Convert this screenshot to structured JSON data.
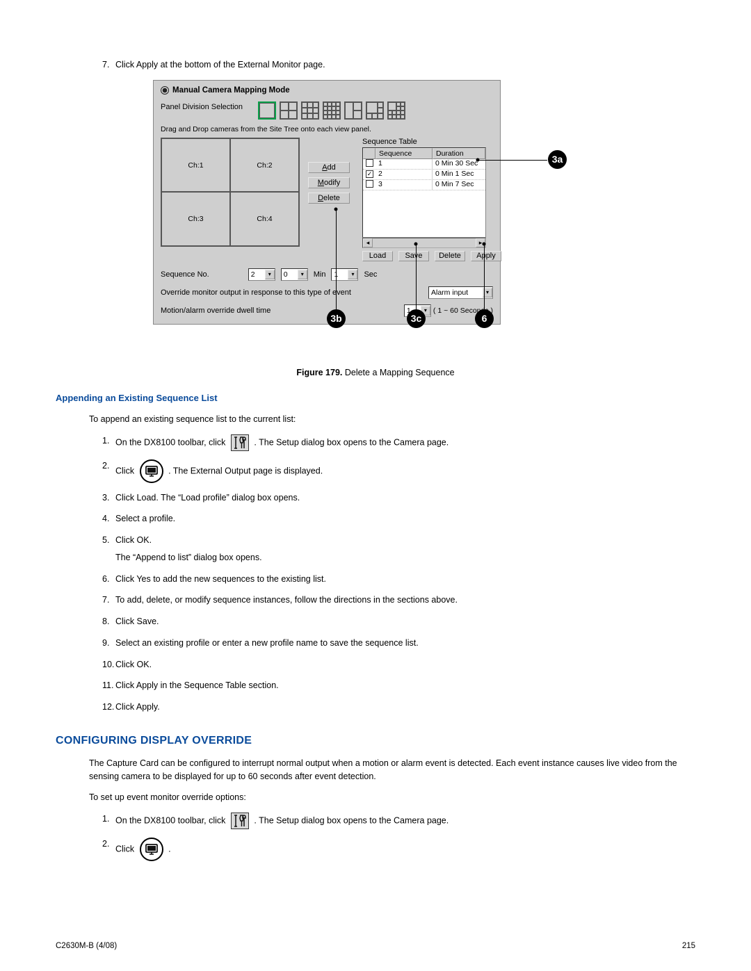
{
  "steps_intro": [
    {
      "num": "7",
      "text": "Click Apply at the bottom of the External Monitor page."
    }
  ],
  "diagram": {
    "mode_label": "Manual Camera Mapping Mode",
    "division_label": "Panel Division Selection",
    "drag_hint": "Drag and Drop cameras from the Site Tree onto each view panel.",
    "channels": [
      "Ch:1",
      "Ch:2",
      "Ch:3",
      "Ch:4"
    ],
    "btns": {
      "add": "Add",
      "modify": "Modify",
      "delete": "Delete"
    },
    "seq_table_title": "Sequence Table",
    "seq_headers": {
      "seq": "Sequence",
      "dur": "Duration"
    },
    "seq_rows": [
      {
        "checked": false,
        "seq": "1",
        "dur": "0 Min 30 Sec"
      },
      {
        "checked": true,
        "seq": "2",
        "dur": "0 Min 1 Sec"
      },
      {
        "checked": false,
        "seq": "3",
        "dur": "0 Min 7 Sec"
      }
    ],
    "bottom_btns": {
      "load": "Load",
      "save": "Save",
      "delete": "Delete",
      "apply": "Apply"
    },
    "seq_no_label": "Sequence No.",
    "seq_no_val": "2",
    "seq_min_val": "0",
    "seq_min_lbl": "Min",
    "seq_sec_val": "1",
    "seq_sec_lbl": "Sec",
    "override_label": "Override monitor output in response to this type of event",
    "override_select": "Alarm input",
    "dwell_label": "Motion/alarm override dwell time",
    "dwell_val": "1",
    "dwell_range": "( 1 ~ 60 Seconds )"
  },
  "figure": {
    "caption_bold": "Figure 179.",
    "caption_rest": " Delete a Mapping Sequence"
  },
  "callouts": {
    "a": "3a",
    "b": "3b",
    "c": "3c",
    "d": "6"
  },
  "append": {
    "title": "Appending an Existing Sequence List",
    "intro": "To append an existing sequence list to the current list:",
    "steps": [
      {
        "num": "1",
        "pre": "On the DX8100 toolbar, click",
        "post": ". The Setup dialog box opens to the Camera page.",
        "icon": "tools"
      },
      {
        "num": "2",
        "pre": "Click",
        "post": ". The External Output page is displayed.",
        "icon": "monitor"
      },
      {
        "num": "3",
        "text": "Click Load. The “Load profile” dialog box opens."
      },
      {
        "num": "4",
        "text": "Select a profile."
      },
      {
        "num": "5",
        "text": "Click OK.",
        "sub": "The “Append to list” dialog box opens."
      },
      {
        "num": "6",
        "text": "Click Yes to add the new sequences to the existing list."
      },
      {
        "num": "7",
        "text": "To add, delete, or modify sequence instances, follow the directions in the sections above."
      },
      {
        "num": "8",
        "text": "Click Save."
      },
      {
        "num": "9",
        "text": "Select an existing profile or enter a new profile name to save the sequence list."
      },
      {
        "num": "10",
        "text": "Click OK."
      },
      {
        "num": "11",
        "text": "Click Apply in the Sequence Table section."
      },
      {
        "num": "12",
        "text": "Click Apply."
      }
    ]
  },
  "configure": {
    "title": "CONFIGURING DISPLAY OVERRIDE",
    "para": "The Capture Card can be configured to interrupt normal output when a motion or alarm event is detected. Each event instance causes live video from the sensing camera to be displayed for up to 60 seconds after event detection.",
    "intro": "To set up event monitor override options:",
    "steps": [
      {
        "num": "1",
        "pre": "On the DX8100 toolbar, click",
        "post": ". The Setup dialog box opens to the Camera page.",
        "icon": "tools"
      },
      {
        "num": "2",
        "pre": "Click",
        "post": ".",
        "icon": "monitor"
      }
    ]
  },
  "footer": {
    "left": "C2630M-B (4/08)",
    "right": "215"
  }
}
